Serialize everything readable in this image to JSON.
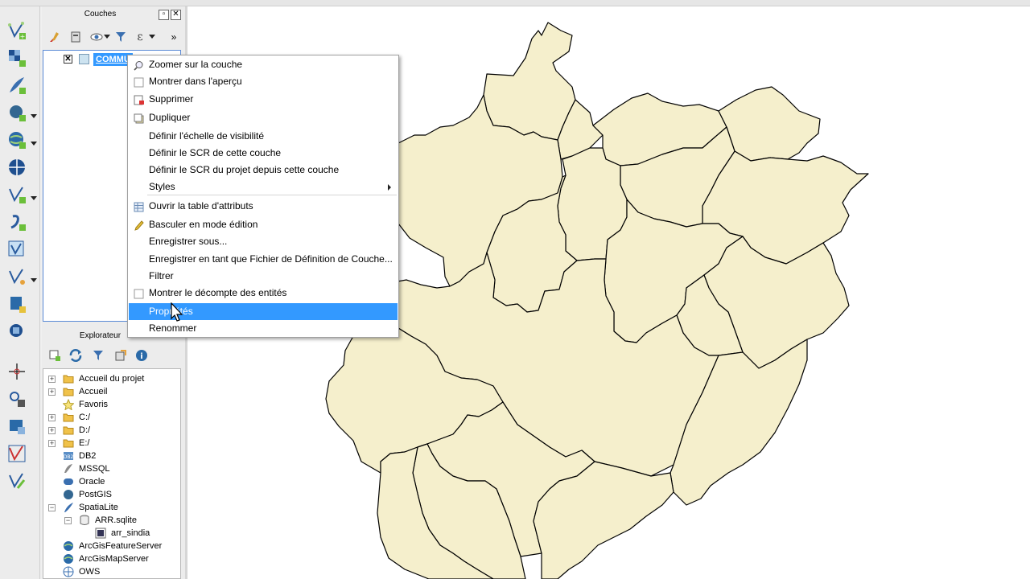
{
  "layers_panel": {
    "title": "Couches",
    "layer": {
      "name": "COMMU",
      "checked": "✕"
    }
  },
  "context_menu": {
    "items": [
      {
        "label": "Zoomer sur la couche",
        "icon": "zoom-icon"
      },
      {
        "label": "Montrer dans l'aperçu",
        "icon": "checkbox-icon"
      },
      {
        "label": "Supprimer",
        "icon": "remove-layer-icon"
      },
      {
        "label": "Dupliquer",
        "icon": "duplicate-icon"
      },
      {
        "label": "Définir l'échelle de visibilité"
      },
      {
        "label": "Définir le SCR de cette couche"
      },
      {
        "label": "Définir le SCR du projet depuis cette couche"
      },
      {
        "label": "Styles",
        "has_submenu": true
      },
      {
        "label": "Ouvrir la table d'attributs",
        "icon": "table-icon"
      },
      {
        "label": "Basculer en mode édition",
        "icon": "pencil-icon"
      },
      {
        "label": "Enregistrer sous..."
      },
      {
        "label": "Enregistrer en tant que Fichier de Définition de Couche..."
      },
      {
        "label": "Filtrer"
      },
      {
        "label": "Montrer le décompte des entités",
        "icon": "checkbox-icon"
      },
      {
        "label": "Propriétés",
        "highlighted": true
      },
      {
        "label": "Renommer"
      }
    ],
    "highlight_color": "#3399ff"
  },
  "explorer_panel": {
    "title": "Explorateur",
    "items": [
      {
        "label": "Accueil du projet",
        "icon": "folder-icon",
        "expandable": true
      },
      {
        "label": "Accueil",
        "icon": "folder-icon",
        "expandable": true
      },
      {
        "label": "Favoris",
        "icon": "star-icon",
        "expandable": false
      },
      {
        "label": "C:/",
        "icon": "folder-icon",
        "expandable": true
      },
      {
        "label": "D:/",
        "icon": "folder-icon",
        "expandable": true
      },
      {
        "label": "E:/",
        "icon": "folder-icon",
        "expandable": true
      },
      {
        "label": "DB2",
        "icon": "db2-icon",
        "expandable": false
      },
      {
        "label": "MSSQL",
        "icon": "mssql-icon",
        "expandable": false
      },
      {
        "label": "Oracle",
        "icon": "oracle-icon",
        "expandable": false
      },
      {
        "label": "PostGIS",
        "icon": "postgis-icon",
        "expandable": false
      },
      {
        "label": "SpatiaLite",
        "icon": "spatialite-icon",
        "expandable": true,
        "expanded": true
      },
      {
        "label": "ARR.sqlite",
        "icon": "database-icon",
        "expandable": true,
        "expanded": true
      },
      {
        "label": "arr_sindia",
        "icon": "polygon-layer-icon",
        "expandable": false
      },
      {
        "label": "ArcGisFeatureServer",
        "icon": "arcgis-icon",
        "expandable": false
      },
      {
        "label": "ArcGisMapServer",
        "icon": "arcgis-icon",
        "expandable": false
      },
      {
        "label": "OWS",
        "icon": "globe-icon",
        "expandable": false
      }
    ]
  },
  "map": {
    "fill_color": "#f5efcc",
    "stroke_color": "#000000",
    "background": "#ffffff"
  }
}
